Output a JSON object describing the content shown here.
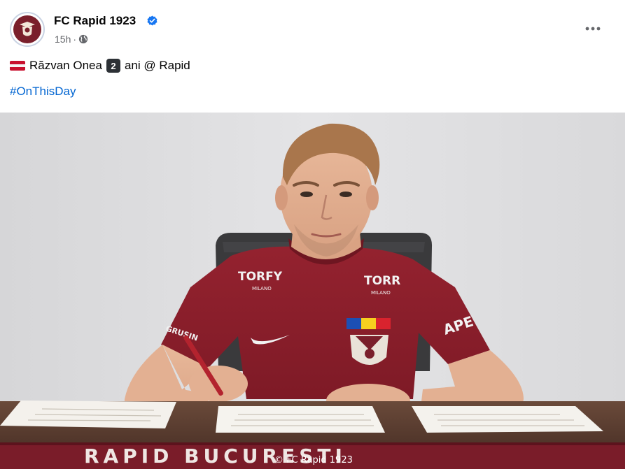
{
  "post": {
    "page_name": "FC Rapid 1923",
    "time": "15h",
    "separator": "·",
    "caption_name": "Răzvan Onea",
    "caption_badge": "2",
    "caption_rest": "ani @ Rapid",
    "hashtag": "#OnThisDay"
  },
  "photo": {
    "sponsor_left": "TORFY",
    "sponsor_left_sub": "MILANO",
    "sponsor_right": "TORR",
    "sponsor_right_sub": "MILANO",
    "sleeve_text": "APE",
    "left_sleeve_text": "GRUSIN",
    "banner_text": "RAPID BUCURESTI",
    "watermark": "© FC Rapid 1923"
  },
  "colors": {
    "link": "#0064d1",
    "jersey": "#8e1f2e",
    "verified": "#1877f2"
  },
  "icons": [
    "verified-icon",
    "globe-icon",
    "more-icon",
    "flag-icon"
  ]
}
